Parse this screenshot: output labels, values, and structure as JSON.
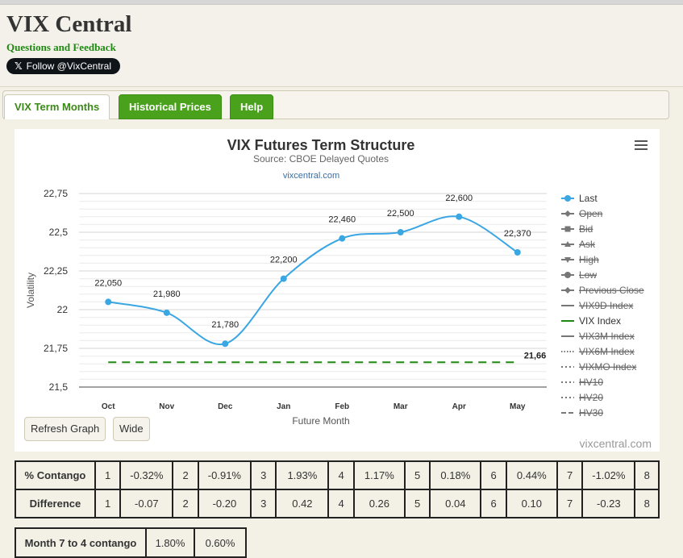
{
  "header": {
    "site_title": "VIX Central",
    "feedback_link": "Questions and Feedback",
    "follow_button": "Follow @VixCentral"
  },
  "tabs": [
    {
      "label": "VIX Term Months",
      "active": true
    },
    {
      "label": "Historical Prices",
      "active": false
    },
    {
      "label": "Help",
      "active": false
    }
  ],
  "chart_data": {
    "type": "line",
    "title": "VIX Futures Term Structure",
    "subtitle": "Source: CBOE Delayed Quotes",
    "credit_small": "vixcentral.com",
    "credit_large": "vixcentral.com",
    "xlabel": "Future Month",
    "ylabel": "Volatility",
    "categories": [
      "Oct",
      "Nov",
      "Dec",
      "Jan",
      "Feb",
      "Mar",
      "Apr",
      "May"
    ],
    "ylim": [
      21.5,
      22.75
    ],
    "yticks": [
      21.5,
      21.75,
      22,
      22.25,
      22.5,
      22.75
    ],
    "ytick_labels": [
      "21,5",
      "21,75",
      "22",
      "22,25",
      "22,5",
      "22,75"
    ],
    "series": [
      {
        "name": "Last",
        "values": [
          22.05,
          21.98,
          21.78,
          22.2,
          22.46,
          22.5,
          22.6,
          22.37
        ],
        "labels": [
          "22,050",
          "21,980",
          "21,780",
          "22,200",
          "22,460",
          "22,500",
          "22,600",
          "22,370"
        ],
        "color": "#3aa6e2",
        "style": "smooth"
      },
      {
        "name": "VIX Index",
        "values": [
          21.66,
          21.66,
          21.66,
          21.66,
          21.66,
          21.66,
          21.66,
          21.66
        ],
        "end_label": "21,66",
        "color": "#1f8a12",
        "style": "dashed"
      }
    ],
    "legend": {
      "placement": "right",
      "items": [
        {
          "name": "Last",
          "enabled": true,
          "marker": "circle",
          "line": "solid",
          "color": "#3aa6e2"
        },
        {
          "name": "Open",
          "enabled": false,
          "marker": "diamond",
          "line": "solid"
        },
        {
          "name": "Bid",
          "enabled": false,
          "marker": "square",
          "line": "solid"
        },
        {
          "name": "Ask",
          "enabled": false,
          "marker": "triangle",
          "line": "solid"
        },
        {
          "name": "High",
          "enabled": false,
          "marker": "triangle-down",
          "line": "solid"
        },
        {
          "name": "Low",
          "enabled": false,
          "marker": "circle",
          "line": "solid"
        },
        {
          "name": "Previous Close",
          "enabled": false,
          "marker": "diamond",
          "line": "solid"
        },
        {
          "name": "VIX9D Index",
          "enabled": false,
          "marker": "none",
          "line": "solid"
        },
        {
          "name": "VIX Index",
          "enabled": true,
          "marker": "none",
          "line": "solid",
          "color": "#1f8a12"
        },
        {
          "name": "VIX3M Index",
          "enabled": false,
          "marker": "none",
          "line": "solid"
        },
        {
          "name": "VIX6M Index",
          "enabled": false,
          "marker": "none",
          "line": "dotted"
        },
        {
          "name": "VIXMO Index",
          "enabled": false,
          "marker": "none",
          "line": "dashdot"
        },
        {
          "name": "HV10",
          "enabled": false,
          "marker": "none",
          "line": "dashdot"
        },
        {
          "name": "HV20",
          "enabled": false,
          "marker": "none",
          "line": "dashdot"
        },
        {
          "name": "HV30",
          "enabled": false,
          "marker": "none",
          "line": "dashed"
        }
      ]
    }
  },
  "buttons": {
    "refresh": "Refresh Graph",
    "wide": "Wide"
  },
  "contango_table": {
    "rows": [
      {
        "label": "% Contango",
        "cells": [
          "1",
          "-0.32%",
          "2",
          "-0.91%",
          "3",
          "1.93%",
          "4",
          "1.17%",
          "5",
          "0.18%",
          "6",
          "0.44%",
          "7",
          "-1.02%",
          "8"
        ]
      },
      {
        "label": "Difference",
        "cells": [
          "1",
          "-0.07",
          "2",
          "-0.20",
          "3",
          "0.42",
          "4",
          "0.26",
          "5",
          "0.04",
          "6",
          "0.10",
          "7",
          "-0.23",
          "8"
        ]
      }
    ]
  },
  "month74_table": {
    "label": "Month 7 to 4 contango",
    "values": [
      "1.80%",
      "0.60%"
    ]
  }
}
